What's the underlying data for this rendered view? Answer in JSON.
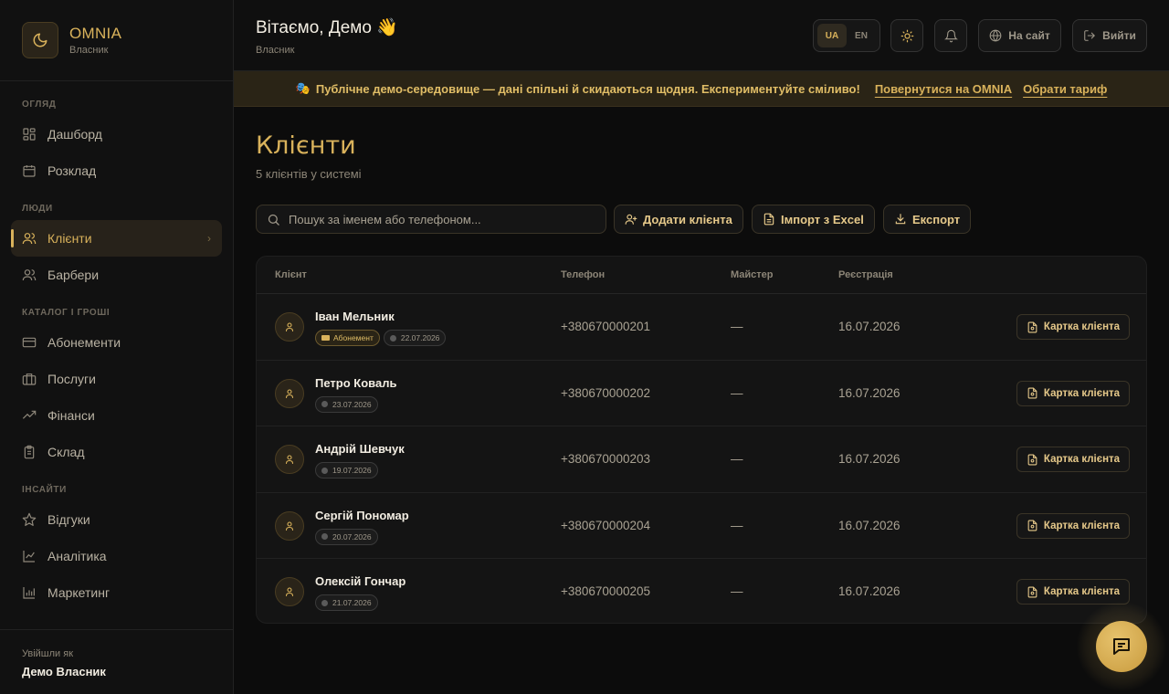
{
  "brand": {
    "name": "OMNIA",
    "role": "Власник"
  },
  "nav": {
    "sections": {
      "overview": "ОГЛЯД",
      "people": "ЛЮДИ",
      "catalog": "КАТАЛОГ І ГРОШІ",
      "insights": "ІНСАЙТИ"
    },
    "items": {
      "dashboard": "Дашборд",
      "schedule": "Розклад",
      "clients": "Клієнти",
      "barbers": "Барбери",
      "subscriptions": "Абонементи",
      "services": "Послуги",
      "finance": "Фінанси",
      "warehouse": "Склад",
      "reviews": "Відгуки",
      "analytics": "Аналітика",
      "marketing": "Маркетинг"
    },
    "active": "clients"
  },
  "footer": {
    "label": "Увійшли як",
    "name": "Демо Власник"
  },
  "header": {
    "greeting": "Вітаємо, Демо 👋",
    "role": "Власник",
    "lang_ua": "UA",
    "lang_en": "EN",
    "site_label": "На сайт",
    "logout_label": "Вийти"
  },
  "banner": {
    "emoji": "🎭",
    "text": "Публічне демо-середовище — дані спільні й скидаються щодня. Експериментуйте сміливо!",
    "back_link": "Повернутися на OMNIA",
    "plan_link": "Обрати тариф"
  },
  "page": {
    "title": "Клієнти",
    "subtitle": "5 клієнтів у системі",
    "search_placeholder": "Пошук за іменем або телефоном...",
    "add_label": "Додати клієнта",
    "import_label": "Імпорт з Excel",
    "export_label": "Експорт"
  },
  "table": {
    "columns": {
      "client": "Клієнт",
      "phone": "Телефон",
      "master": "Майстер",
      "registered": "Реєстрація"
    },
    "card_label": "Картка клієнта",
    "subscription_label": "Абонемент",
    "rows": [
      {
        "name": "Іван Мельник",
        "has_subscription": true,
        "date_chip": "22.07.2026",
        "phone": "+380670000201",
        "master": "—",
        "registered": "16.07.2026"
      },
      {
        "name": "Петро Коваль",
        "has_subscription": false,
        "date_chip": "23.07.2026",
        "phone": "+380670000202",
        "master": "—",
        "registered": "16.07.2026"
      },
      {
        "name": "Андрій Шевчук",
        "has_subscription": false,
        "date_chip": "19.07.2026",
        "phone": "+380670000203",
        "master": "—",
        "registered": "16.07.2026"
      },
      {
        "name": "Сергій Пономар",
        "has_subscription": false,
        "date_chip": "20.07.2026",
        "phone": "+380670000204",
        "master": "—",
        "registered": "16.07.2026"
      },
      {
        "name": "Олексій Гончар",
        "has_subscription": false,
        "date_chip": "21.07.2026",
        "phone": "+380670000205",
        "master": "—",
        "registered": "16.07.2026"
      }
    ]
  },
  "colors": {
    "accent": "#d9b25b",
    "background": "#0c0c0c",
    "sidebar": "#111111",
    "banner": "#2a2416"
  },
  "icons": [
    "moon-icon",
    "dashboard-icon",
    "calendar-icon",
    "users-icon",
    "card-icon",
    "briefcase-icon",
    "trend-icon",
    "clipboard-icon",
    "star-icon",
    "chart-icon",
    "bar-chart-icon",
    "sun-icon",
    "bell-icon",
    "globe-icon",
    "logout-icon",
    "search-icon",
    "user-plus-icon",
    "file-icon",
    "download-icon",
    "user-icon",
    "user-card-icon",
    "chat-icon"
  ]
}
